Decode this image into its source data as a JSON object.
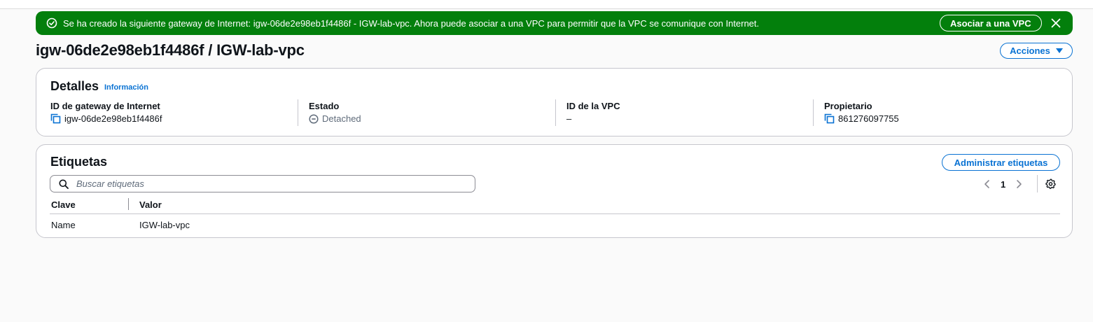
{
  "flash": {
    "message": "Se ha creado la siguiente gateway de Internet: igw-06de2e98eb1f4486f - IGW-lab-vpc. Ahora puede asociar a una VPC para permitir que la VPC se comunique con Internet.",
    "action_label": "Asociar a una VPC",
    "icon": "check-circle-icon",
    "color": "#037f0c"
  },
  "page": {
    "title": "igw-06de2e98eb1f4486f / IGW-lab-vpc",
    "actions_label": "Acciones"
  },
  "details": {
    "title": "Detalles",
    "info_label": "Información",
    "columns": [
      {
        "label": "ID de gateway de Internet",
        "value": "igw-06de2e98eb1f4486f"
      },
      {
        "label": "Estado",
        "value": "Detached"
      },
      {
        "label": "ID de la VPC",
        "value": "–"
      },
      {
        "label": "Propietario",
        "value": "861276097755"
      }
    ]
  },
  "tags": {
    "title": "Etiquetas",
    "manage_label": "Administrar etiquetas",
    "search_placeholder": "Buscar etiquetas",
    "page_number": "1",
    "headers": [
      "Clave",
      "Valor"
    ],
    "rows": [
      {
        "key": "Name",
        "value": "IGW-lab-vpc"
      }
    ]
  },
  "colors": {
    "accent": "#0972d3",
    "success": "#037f0c",
    "border": "#c6c6cd"
  }
}
